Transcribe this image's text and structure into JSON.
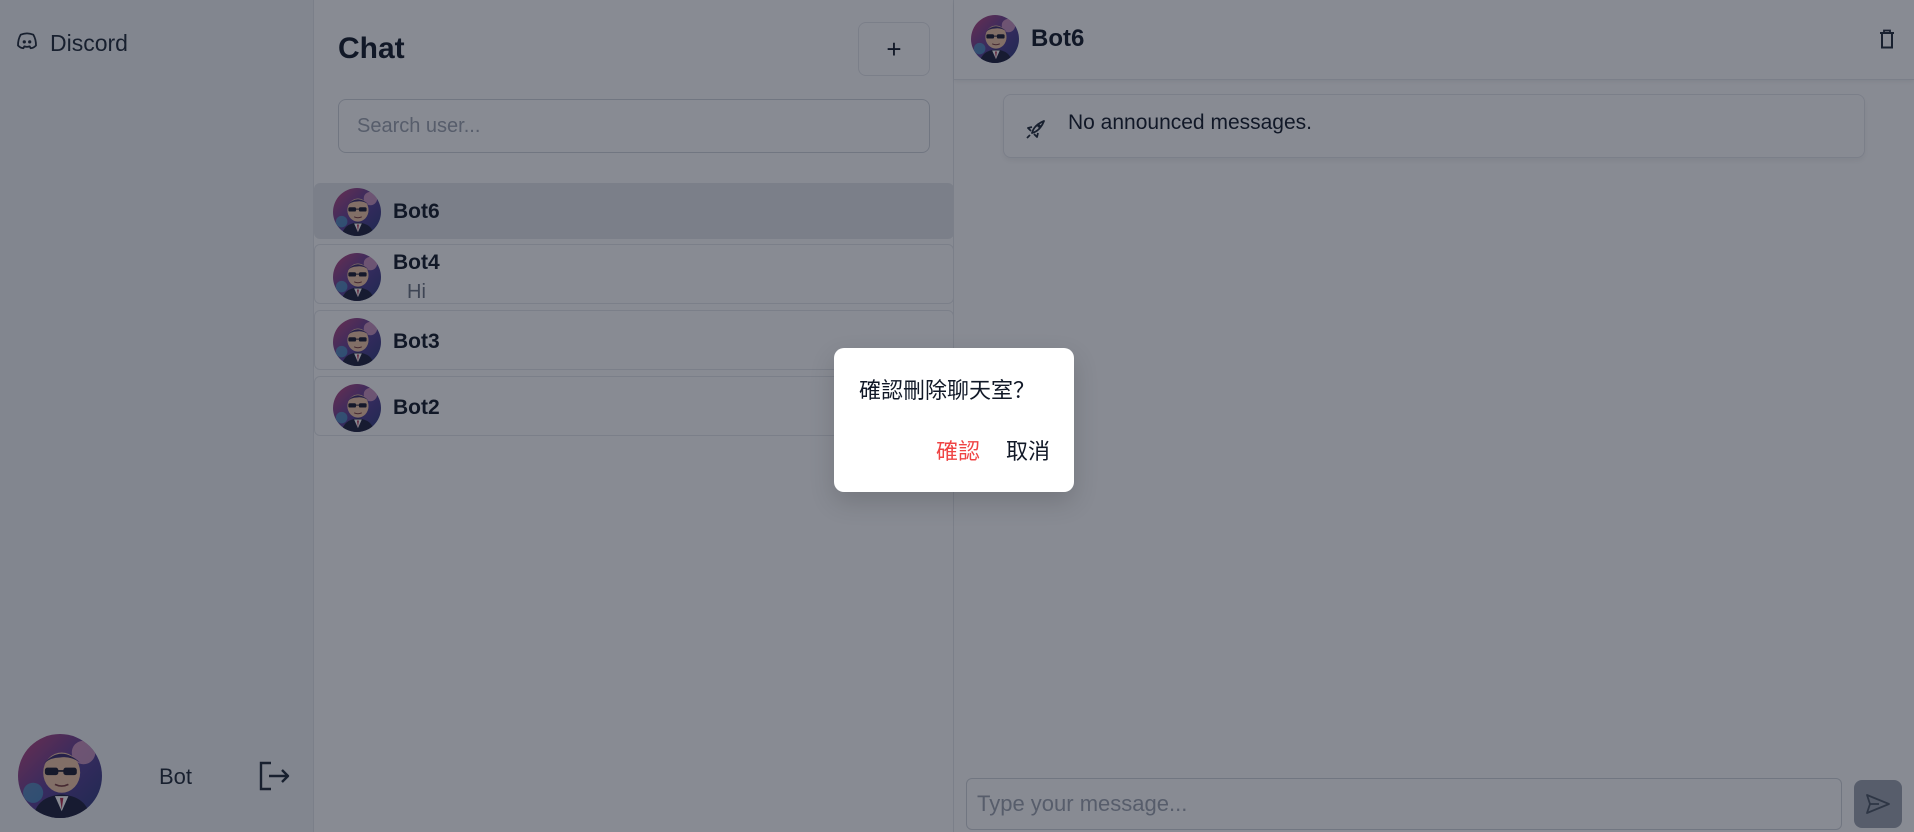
{
  "app": {
    "brand_label": "Discord",
    "brand_icon": "discord-icon"
  },
  "profile": {
    "name": "Bot",
    "avatar_icon": "user-avatar",
    "logout_icon": "logout-icon"
  },
  "list": {
    "title": "Chat",
    "new_chat_label": "+",
    "search_placeholder": "Search user...",
    "conversations": [
      {
        "name": "Bot6",
        "preview": "",
        "active": true
      },
      {
        "name": "Bot4",
        "preview": "Hi",
        "active": false
      },
      {
        "name": "Bot3",
        "preview": "",
        "active": false
      },
      {
        "name": "Bot2",
        "preview": "",
        "active": false
      }
    ]
  },
  "pane": {
    "title": "Bot6",
    "delete_icon": "trash-icon",
    "announcement_icon": "rocket-icon",
    "announcement_text": "No announced messages.",
    "composer_placeholder": "Type your message...",
    "send_icon": "send-icon"
  },
  "dialog": {
    "message": "確認刪除聊天室？",
    "confirm_label": "確認",
    "cancel_label": "取消"
  },
  "colors": {
    "accent_danger": "#ef4444",
    "overlay": "rgba(17,24,39,0.5)",
    "send_disabled": "#9ca3af"
  }
}
